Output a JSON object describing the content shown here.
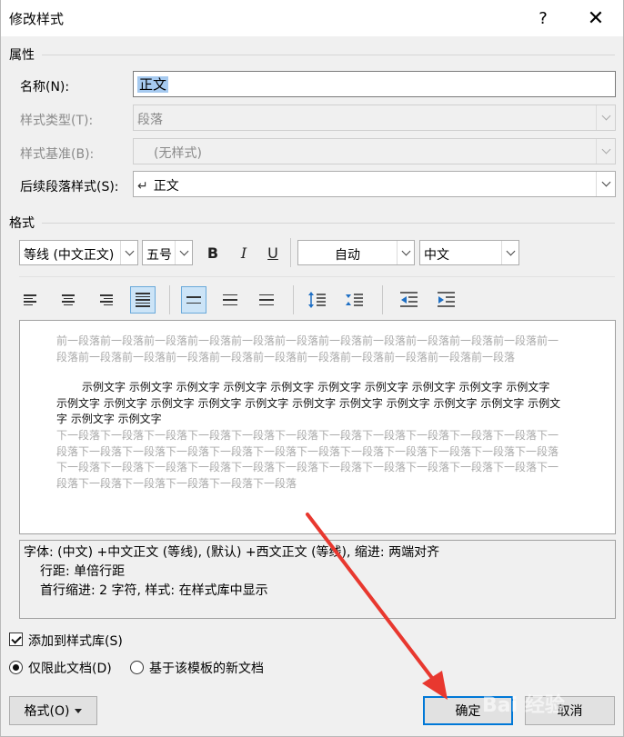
{
  "window": {
    "title": "修改样式",
    "help": "?",
    "close": "✕"
  },
  "properties": {
    "section": "属性",
    "name_label": "名称(N):",
    "name_value": "正文",
    "type_label": "样式类型(T):",
    "type_value": "段落",
    "base_label": "样式基准(B):",
    "base_value": "(无样式)",
    "next_label": "后续段落样式(S):",
    "next_value": "正文",
    "next_icon": "↵"
  },
  "format": {
    "section": "格式",
    "font": "等线 (中文正文)",
    "size": "五号",
    "bold": "B",
    "italic": "I",
    "underline": "U",
    "color": "自动",
    "script": "中文"
  },
  "preview": {
    "prev_para": "前一段落前一段落前一段落前一段落前一段落前一段落前一段落前一段落前一段落前一段落前一段落前一段落前一段落前一段落前一段落前一段落前一段落前一段落前一段落前一段落前一段落前一段落",
    "sample": "示例文字 示例文字 示例文字 示例文字 示例文字 示例文字 示例文字 示例文字 示例文字 示例文字 示例文字 示例文字 示例文字 示例文字 示例文字 示例文字 示例文字 示例文字 示例文字 示例文字 示例文字 示例文字 示例文字",
    "next_para": "下一段落下一段落下一段落下一段落下一段落下一段落下一段落下一段落下一段落下一段落下一段落下一段落下一段落下一段落下一段落下一段落下一段落下一段落下一段落下一段落下一段落下一段落下一段落下一段落下一段落下一段落下一段落下一段落下一段落下一段落下一段落下一段落下一段落下一段落下一段落下一段落下一段落下一段落下一段落下一段落"
  },
  "description": {
    "line1": "字体: (中文) +中文正文 (等线), (默认) +西文正文 (等线), 缩进: 两端对齐",
    "line2": "行距: 单倍行距",
    "line3": "首行缩进:  2 字符, 样式: 在样式库中显示"
  },
  "options": {
    "add_to_gallery": "添加到样式库(S)",
    "only_this_doc": "仅限此文档(D)",
    "new_docs_template": "基于该模板的新文档"
  },
  "buttons": {
    "format": "格式(O)",
    "ok": "确定",
    "cancel": "取消"
  },
  "watermark": "Bai 经验"
}
